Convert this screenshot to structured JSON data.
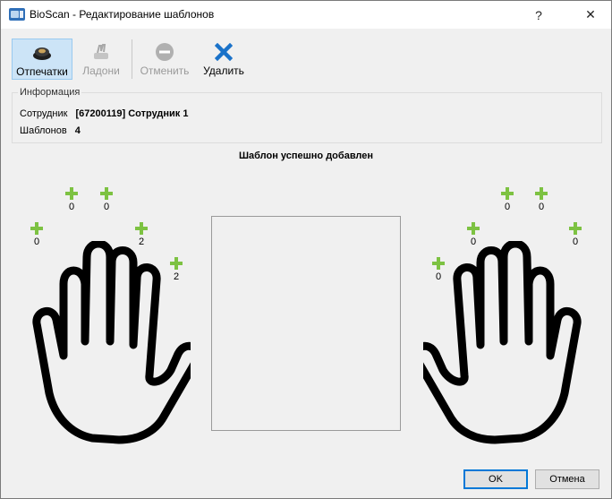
{
  "window": {
    "title": "BioScan - Редактирование шаблонов",
    "help_label": "?",
    "close_label": "✕"
  },
  "toolbar": {
    "fingerprints_label": "Отпечатки",
    "palms_label": "Ладони",
    "cancel_label": "Отменить",
    "delete_label": "Удалить"
  },
  "info": {
    "legend": "Информация",
    "employee_key": "Сотрудник",
    "employee_value": "[67200119] Сотрудник 1",
    "templates_key": "Шаблонов",
    "templates_value": "4"
  },
  "status_message": "Шаблон успешно добавлен",
  "fingers": {
    "left": [
      "0",
      "0",
      "0",
      "2",
      "2"
    ],
    "right": [
      "0",
      "0",
      "0",
      "0",
      "0"
    ]
  },
  "buttons": {
    "ok": "OK",
    "cancel": "Отмена"
  },
  "colors": {
    "plus": "#7dc242",
    "delete_icon": "#1a72c9",
    "active_tab": "#cce4f7"
  }
}
